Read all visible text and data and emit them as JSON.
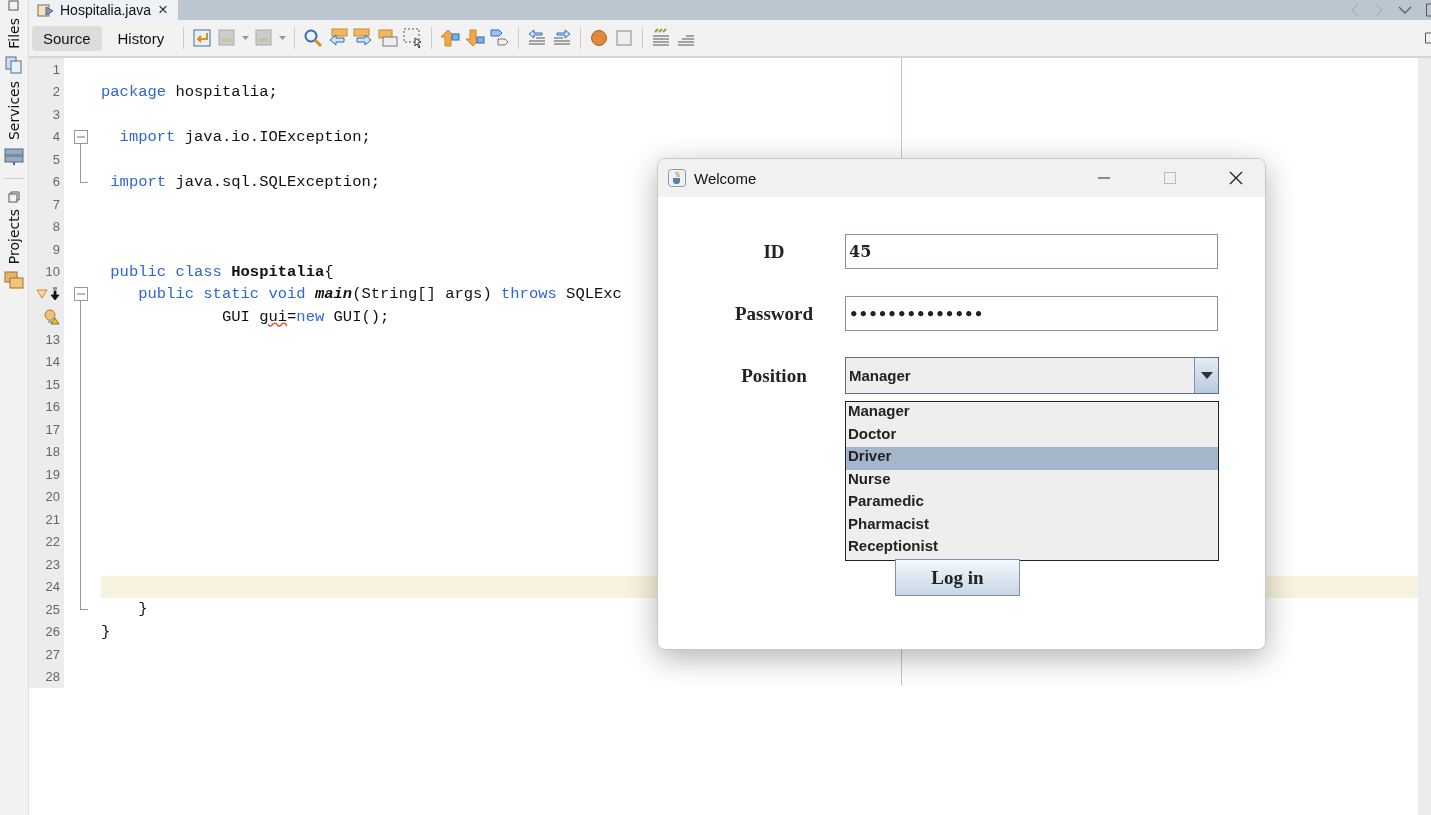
{
  "side_tabs": [
    {
      "label": "Files"
    },
    {
      "label": "Services"
    },
    {
      "label": "Projects"
    }
  ],
  "editor_tabs": [
    {
      "label": "Hospitalia.java",
      "selected": true,
      "close": "×"
    }
  ],
  "view_tabs": [
    {
      "label": "Source",
      "selected": true
    },
    {
      "label": "History",
      "selected": false
    }
  ],
  "code_lines": [
    {
      "number": "1",
      "current": false
    },
    {
      "number": "2",
      "current": false,
      "tokens": [
        {
          "text": "package",
          "kind": "keyword"
        },
        {
          "text": " hospitalia;",
          "kind": "plain"
        }
      ]
    },
    {
      "number": "3",
      "current": false
    },
    {
      "number": "4",
      "current": false,
      "fold_start": true,
      "tokens": [
        {
          "text": "  import",
          "kind": "keyword"
        },
        {
          "text": " java.io.IOException;",
          "kind": "plain"
        }
      ]
    },
    {
      "number": "5",
      "current": false,
      "fold_body": true
    },
    {
      "number": "6",
      "current": false,
      "fold_end": true,
      "tokens": [
        {
          "text": " import",
          "kind": "keyword"
        },
        {
          "text": " java.sql.SQLException;",
          "kind": "plain"
        }
      ]
    },
    {
      "number": "7",
      "current": false
    },
    {
      "number": "8",
      "current": false
    },
    {
      "number": "9",
      "current": false
    },
    {
      "number": "10",
      "current": false,
      "tokens": [
        {
          "text": " public class",
          "kind": "keyword"
        },
        {
          "text": " Hospitalia",
          "kind": "type"
        },
        {
          "text": "{",
          "kind": "plain"
        }
      ]
    },
    {
      "current": false,
      "fold_start": true,
      "override_mark": true,
      "tokens": [
        {
          "text": "    public static void",
          "kind": "keyword"
        },
        {
          "text": " main",
          "kind": "method"
        },
        {
          "text": "(String[] args) ",
          "kind": "plain"
        },
        {
          "text": "throws",
          "kind": "keyword"
        },
        {
          "text": " SQLExc",
          "kind": "plain"
        }
      ]
    },
    {
      "current": false,
      "fold_body": true,
      "warning": true,
      "tokens": [
        {
          "text": "             GUI ",
          "kind": "plain"
        },
        {
          "text": "gui",
          "kind": "error"
        },
        {
          "text": "=",
          "kind": "plain"
        },
        {
          "text": "new",
          "kind": "keyword"
        },
        {
          "text": " GUI();",
          "kind": "plain"
        }
      ]
    },
    {
      "number": "13",
      "current": false,
      "fold_body": true
    },
    {
      "number": "14",
      "current": false,
      "fold_body": true
    },
    {
      "number": "15",
      "current": false,
      "fold_body": true
    },
    {
      "number": "16",
      "current": false,
      "fold_body": true
    },
    {
      "number": "17",
      "current": false,
      "fold_body": true
    },
    {
      "number": "18",
      "current": false,
      "fold_body": true
    },
    {
      "number": "19",
      "current": false,
      "fold_body": true
    },
    {
      "number": "20",
      "current": false,
      "fold_body": true
    },
    {
      "number": "21",
      "current": false,
      "fold_body": true
    },
    {
      "number": "22",
      "current": false,
      "fold_body": true
    },
    {
      "number": "23",
      "current": false,
      "fold_body": true
    },
    {
      "number": "24",
      "current": true,
      "fold_body": true
    },
    {
      "number": "25",
      "current": false,
      "fold_end": true,
      "tokens": [
        {
          "text": "    }",
          "kind": "plain"
        }
      ]
    },
    {
      "number": "26",
      "current": false,
      "tokens": [
        {
          "text": "}",
          "kind": "plain"
        }
      ]
    },
    {
      "number": "27",
      "current": false
    },
    {
      "number": "28",
      "current": false
    }
  ],
  "dialog": {
    "title": "Welcome",
    "fields": [
      {
        "label": "ID",
        "kind": "text",
        "value": "45"
      },
      {
        "label": "Password",
        "kind": "password",
        "value": "••••••••••••••"
      },
      {
        "label": "Position",
        "kind": "combo",
        "value": "Manager",
        "expanded": true
      }
    ],
    "options": [
      {
        "label": "Manager",
        "selected": false
      },
      {
        "label": "Doctor",
        "selected": false
      },
      {
        "label": "Driver",
        "selected": true
      },
      {
        "label": "Nurse",
        "selected": false
      },
      {
        "label": "Paramedic",
        "selected": false
      },
      {
        "label": "Pharmacist",
        "selected": false
      },
      {
        "label": "Receptionist",
        "selected": false
      }
    ],
    "button": "Log in"
  }
}
